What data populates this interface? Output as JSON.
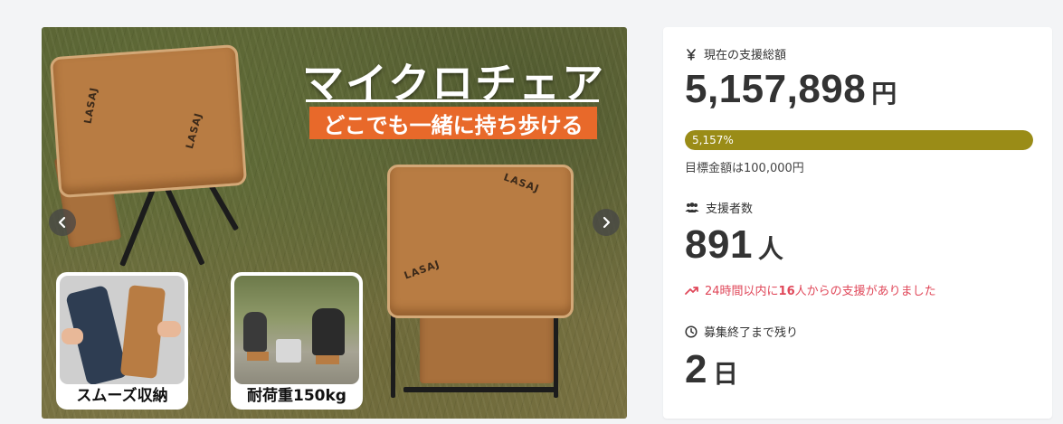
{
  "gallery": {
    "headline": "マイクロチェア",
    "subheadline": "どこでも一緒に持ち歩ける",
    "brand": "LASAJ",
    "thumbs": [
      {
        "caption": "スムーズ収納"
      },
      {
        "caption": "耐荷重150kg"
      }
    ],
    "nav": {
      "prev_icon": "chevron-left-icon",
      "next_icon": "chevron-right-icon"
    }
  },
  "funding": {
    "total_label": "現在の支援総額",
    "total_icon": "yen-icon",
    "total_value": "5,157,898",
    "total_unit": "円",
    "progress_percent_text": "5,157%",
    "progress_fraction": 1.0,
    "goal_text": "目標金額は100,000円",
    "supporters_label": "支援者数",
    "supporters_icon": "users-icon",
    "supporters_value": "891",
    "supporters_unit": "人",
    "trend_prefix": "24時間以内に",
    "trend_count": "16",
    "trend_suffix": "人からの支援がありました",
    "remaining_label": "募集終了まで残り",
    "remaining_icon": "clock-icon",
    "remaining_value": "2",
    "remaining_unit": "日"
  },
  "colors": {
    "accent": "#9a8c17",
    "trend": "#e0485a",
    "sub_banner": "#e8692a",
    "background": "#f3f4f6"
  }
}
